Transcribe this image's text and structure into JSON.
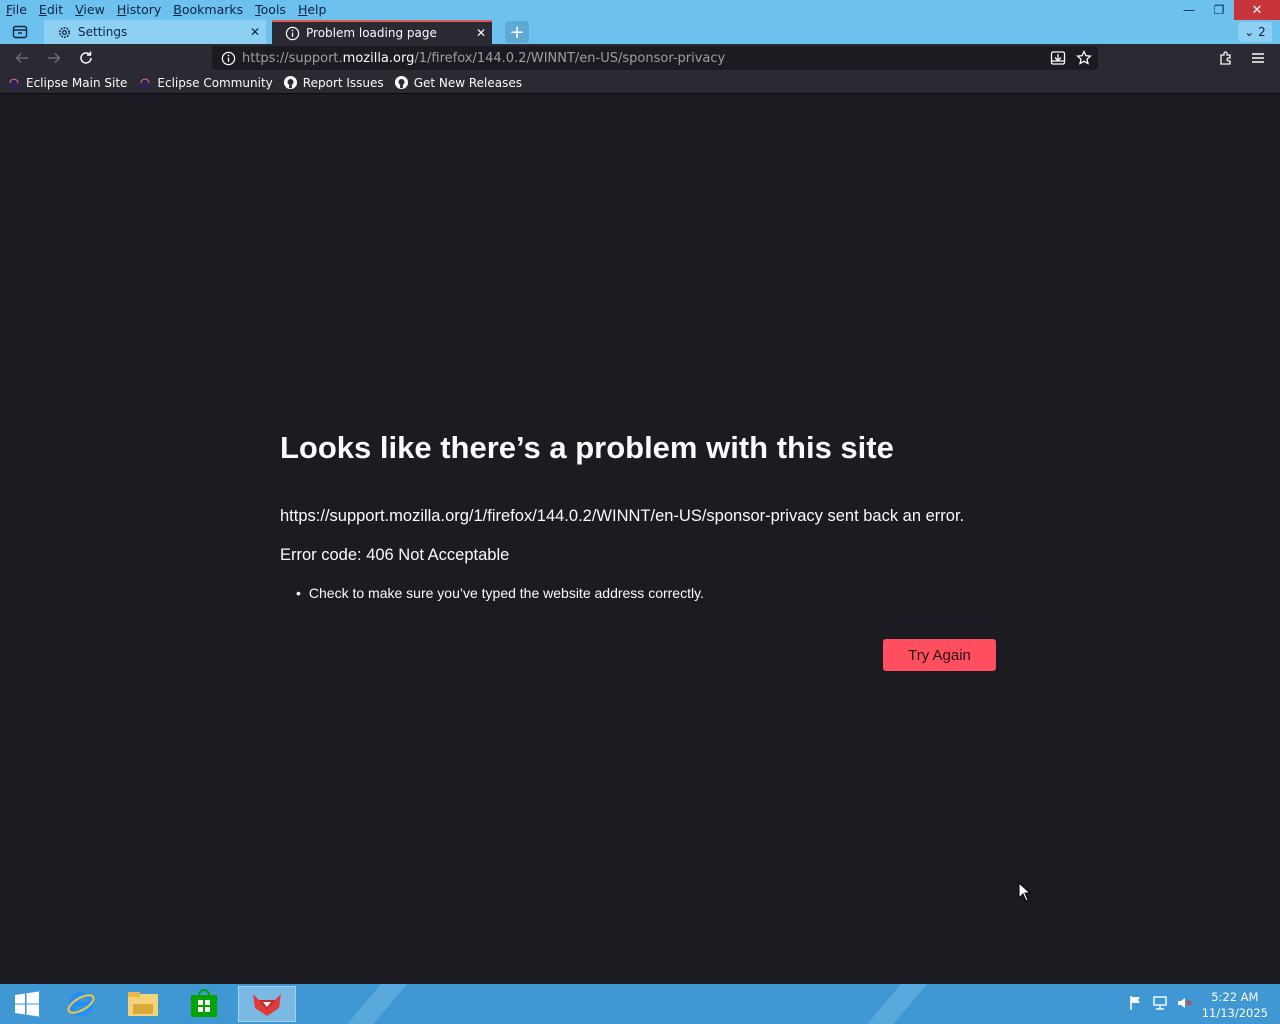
{
  "menu": [
    "File",
    "Edit",
    "View",
    "History",
    "Bookmarks",
    "Tools",
    "Help"
  ],
  "menu_underline": [
    "F",
    "E",
    "V",
    "H",
    "B",
    "T",
    "H"
  ],
  "tabs": [
    {
      "label": "Settings",
      "icon": "gear-icon"
    },
    {
      "label": "Problem loading page",
      "icon": "info-icon"
    }
  ],
  "tab_overflow_count": "2",
  "url": {
    "prefix": "https://support.",
    "host": "mozilla.org",
    "path": "/1/firefox/144.0.2/WINNT/en-US/sponsor-privacy"
  },
  "bookmarks": [
    {
      "label": "Eclipse Main Site",
      "icon": "eclipse-icon"
    },
    {
      "label": "Eclipse Community",
      "icon": "eclipse-icon"
    },
    {
      "label": "Report Issues",
      "icon": "github-icon"
    },
    {
      "label": "Get New Releases",
      "icon": "github-icon"
    }
  ],
  "error": {
    "title": "Looks like there’s a problem with this site",
    "description": "https://support.mozilla.org/1/firefox/144.0.2/WINNT/en-US/sponsor-privacy sent back an error.",
    "code": "Error code: 406 Not Acceptable",
    "suggestions": [
      "Check to make sure you’ve typed the website address correctly."
    ],
    "button": "Try Again"
  },
  "clock": {
    "time": "5:22 AM",
    "date": "11/13/2025"
  },
  "colors": {
    "accent": "#ff4f5e",
    "titlebar": "#6cc1ef",
    "taskbar": "#3f97d3",
    "content_bg": "#1c1b22"
  }
}
